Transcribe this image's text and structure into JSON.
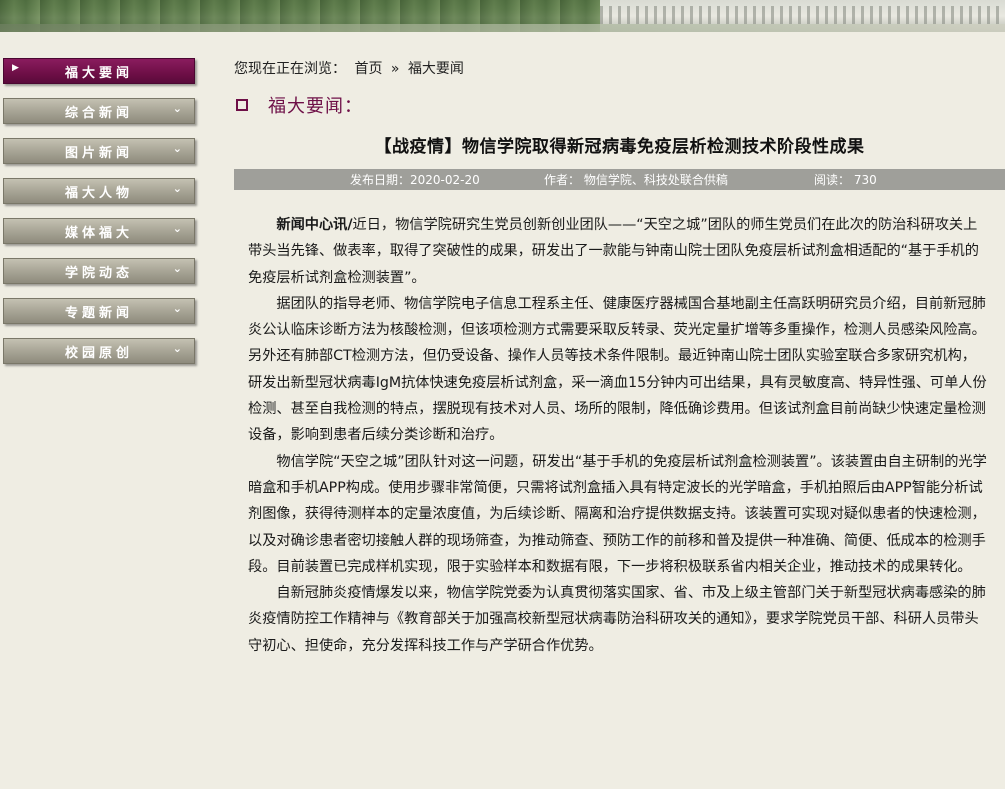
{
  "banner": {},
  "sidebar": {
    "items": [
      {
        "label": "福大要闻",
        "active": true
      },
      {
        "label": "综合新闻",
        "active": false
      },
      {
        "label": "图片新闻",
        "active": false
      },
      {
        "label": "福大人物",
        "active": false
      },
      {
        "label": "媒体福大",
        "active": false
      },
      {
        "label": "学院动态",
        "active": false
      },
      {
        "label": "专题新闻",
        "active": false
      },
      {
        "label": "校园原创",
        "active": false
      }
    ]
  },
  "breadcrumb": {
    "prefix": "您现在正在浏览：",
    "home": "首页",
    "separator": "»",
    "current": "福大要闻"
  },
  "section": {
    "title": "福大要闻："
  },
  "article": {
    "title": "【战疫情】物信学院取得新冠病毒免疫层析检测技术阶段性成果",
    "meta": {
      "date": "发布日期：2020-02-20",
      "author": "作者： 物信学院、科技处联合供稿",
      "views": "阅读： 730"
    },
    "lead": "新闻中心讯/",
    "paragraphs": [
      "近日，物信学院研究生党员创新创业团队——“天空之城”团队的师生党员们在此次的防治科研攻关上带头当先锋、做表率，取得了突破性的成果，研发出了一款能与钟南山院士团队免疫层析试剂盒相适配的“基于手机的免疫层析试剂盒检测装置”。",
      "据团队的指导老师、物信学院电子信息工程系主任、健康医疗器械国合基地副主任高跃明研究员介绍，目前新冠肺炎公认临床诊断方法为核酸检测，但该项检测方式需要采取反转录、荧光定量扩增等多重操作，检测人员感染风险高。另外还有肺部CT检测方法，但仍受设备、操作人员等技术条件限制。最近钟南山院士团队实验室联合多家研究机构，研发出新型冠状病毒IgM抗体快速免疫层析试剂盒，采一滴血15分钟内可出结果，具有灵敏度高、特异性强、可单人份检测、甚至自我检测的特点，摆脱现有技术对人员、场所的限制，降低确诊费用。但该试剂盒目前尚缺少快速定量检测设备，影响到患者后续分类诊断和治疗。",
      "物信学院“天空之城”团队针对这一问题，研发出“基于手机的免疫层析试剂盒检测装置”。该装置由自主研制的光学暗盒和手机APP构成。使用步骤非常简便，只需将试剂盒插入具有特定波长的光学暗盒，手机拍照后由APP智能分析试剂图像，获得待测样本的定量浓度值，为后续诊断、隔离和治疗提供数据支持。该装置可实现对疑似患者的快速检测，以及对确诊患者密切接触人群的现场筛查，为推动筛查、预防工作的前移和普及提供一种准确、简便、低成本的检测手段。目前装置已完成样机实现，限于实验样本和数据有限，下一步将积极联系省内相关企业，推动技术的成果转化。",
      "自新冠肺炎疫情爆发以来，物信学院党委为认真贯彻落实国家、省、市及上级主管部门关于新型冠状病毒感染的肺炎疫情防控工作精神与《教育部关于加强高校新型冠状病毒防治科研攻关的通知》，要求学院党员干部、科研人员带头守初心、担使命，充分发挥科技工作与产学研合作优势。"
    ]
  }
}
